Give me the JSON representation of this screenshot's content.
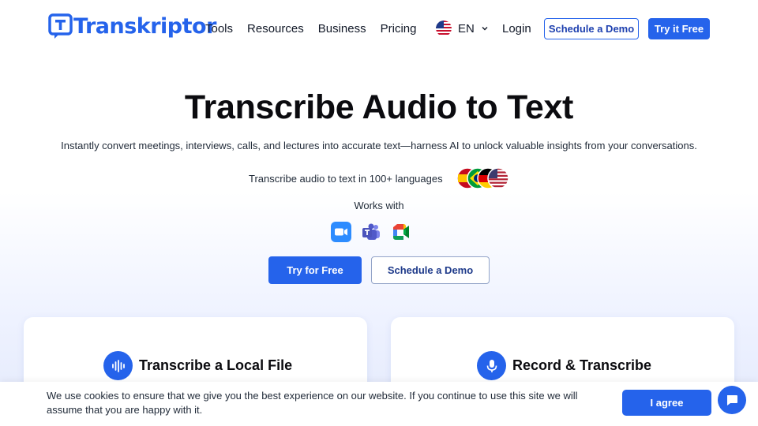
{
  "nav": {
    "logo_text": "Transkriptor",
    "links": [
      "Tools",
      "Resources",
      "Business",
      "Pricing"
    ],
    "language": "EN",
    "login": "Login",
    "demo_button": "Schedule a Demo",
    "try_button": "Try it Free"
  },
  "hero": {
    "title": "Transcribe Audio to Text",
    "subtitle": "Instantly convert meetings, interviews, calls, and lectures into accurate text—harness AI to unlock valuable insights from your conversations.",
    "languages_text": "Transcribe audio to text in 100+ languages",
    "works_with": "Works with",
    "apps": [
      "zoom-icon",
      "teams-icon",
      "meet-icon"
    ],
    "cta_primary": "Try for Free",
    "cta_secondary": "Schedule a Demo"
  },
  "cards": {
    "left_title": "Transcribe a Local File",
    "right_title": "Record & Transcribe"
  },
  "cookie": {
    "text": "We use cookies to ensure that we give you the best experience on our website. If you continue to use this site we will assume that you are happy with it.",
    "agree": "I agree"
  },
  "colors": {
    "brand": "#2563eb",
    "text": "#111827"
  }
}
